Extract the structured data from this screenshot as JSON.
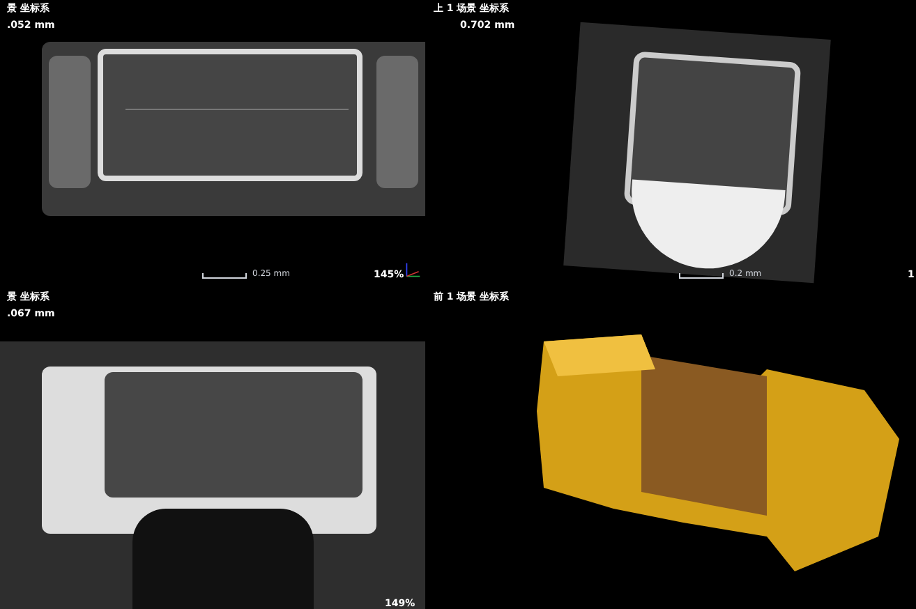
{
  "panes": [
    {
      "kind": "cross",
      "label": "景 坐标系",
      "depth": ".052 mm",
      "scale": "0.25 mm",
      "zoom": "145%"
    },
    {
      "kind": "square",
      "label": "上 1 场景 坐标系",
      "depth": "0.702 mm",
      "scale": "0.2 mm",
      "zoom": "1"
    },
    {
      "kind": "open",
      "label": "景 坐标系",
      "depth": ".067 mm",
      "zoom": "149%"
    },
    {
      "kind": "render3d",
      "label": "前 1 场景 坐标系"
    }
  ]
}
